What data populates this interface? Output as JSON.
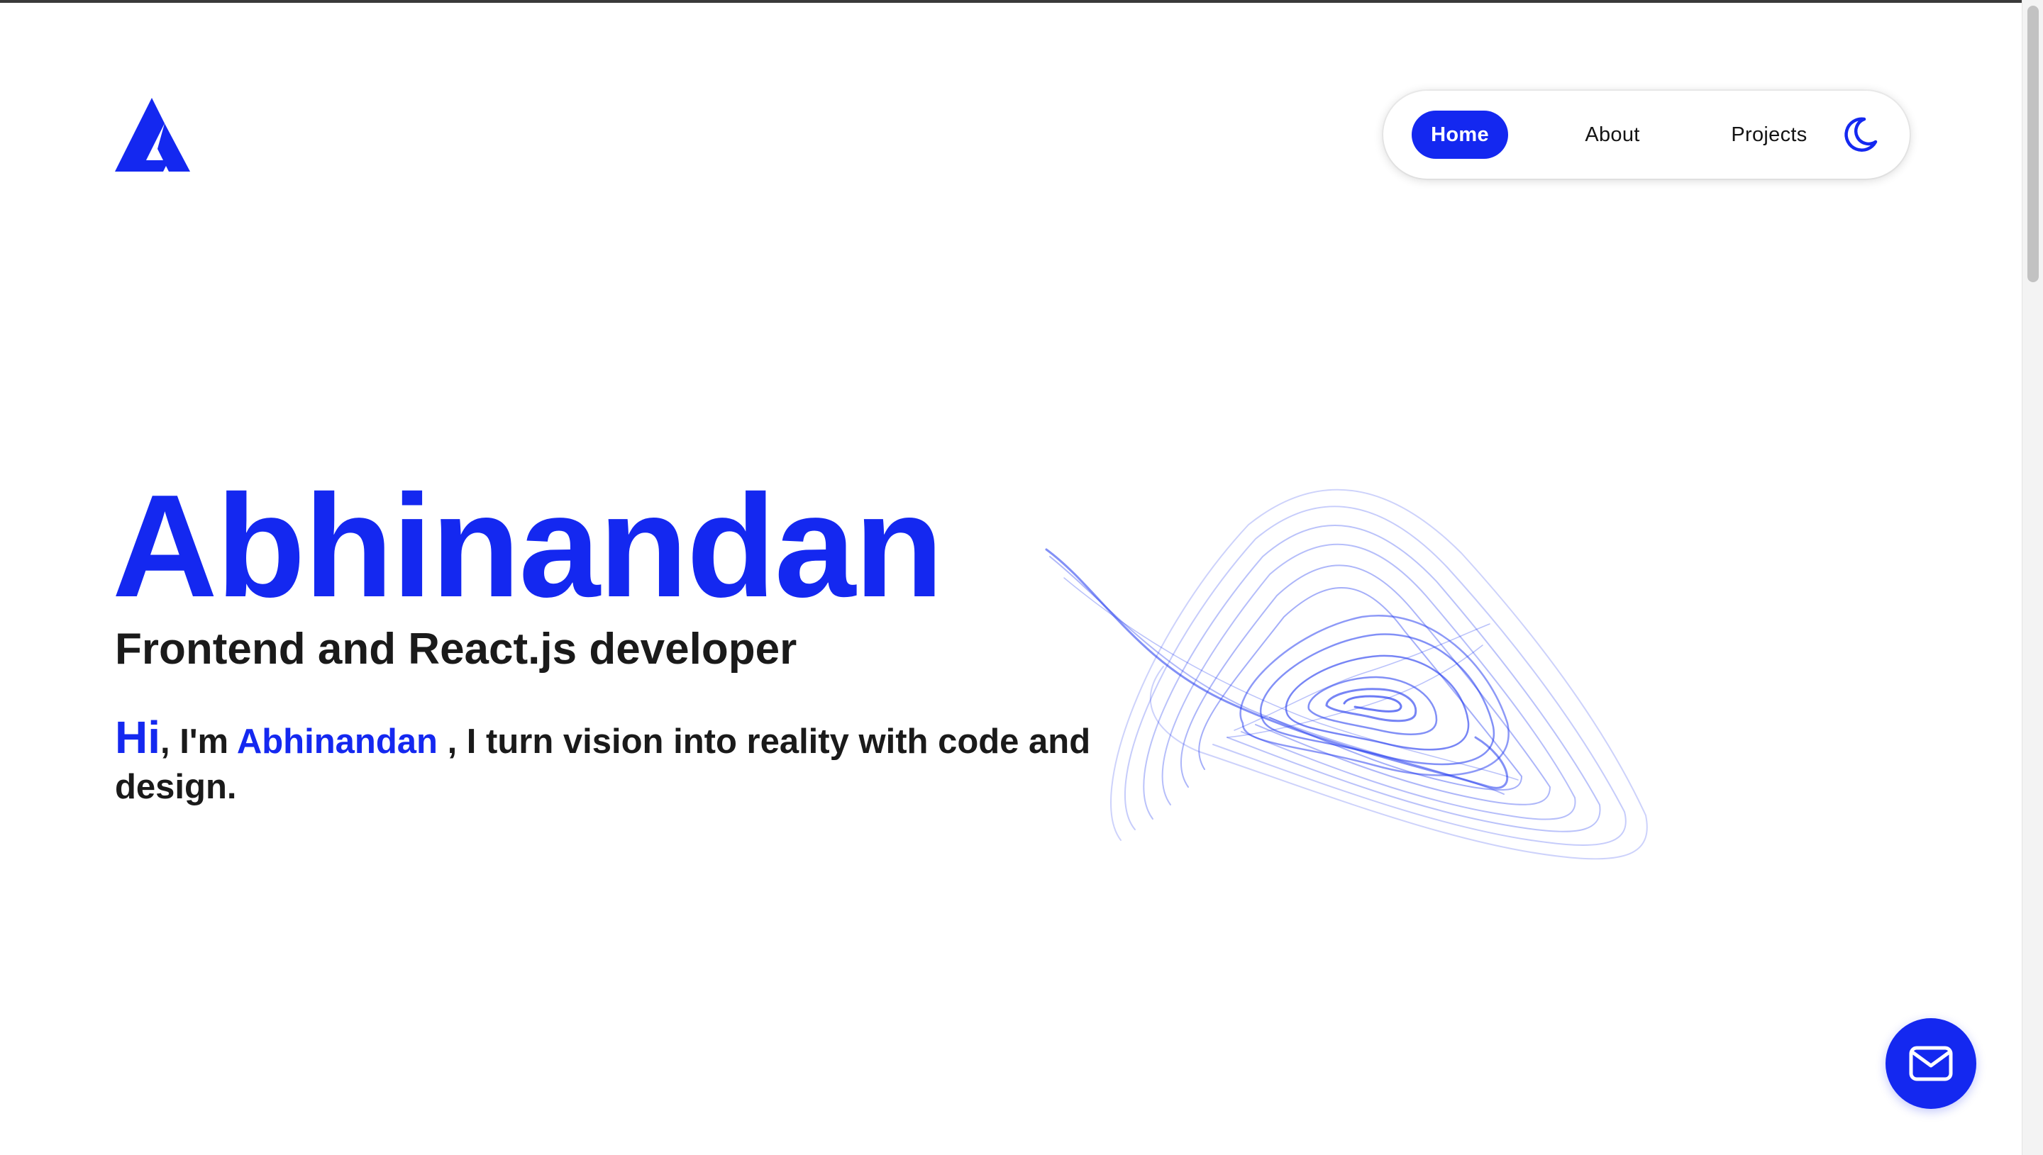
{
  "nav": {
    "items": [
      {
        "label": "Home",
        "active": true
      },
      {
        "label": "About",
        "active": false
      },
      {
        "label": "Projects",
        "active": false
      }
    ],
    "theme_icon": "moon-icon"
  },
  "hero": {
    "name": "Abhinandan",
    "role": "Frontend and React.js developer",
    "intro": {
      "greeting": "Hi",
      "part1": ", I'm ",
      "name": "Abhinandan",
      "part2": " , I turn vision into reality with code and design."
    }
  },
  "logo_icon": "a-letter-logo-icon",
  "contact_icon": "mail-icon",
  "colors": {
    "accent": "#1428f0",
    "text": "#1a1a1a",
    "background": "#ffffff"
  }
}
